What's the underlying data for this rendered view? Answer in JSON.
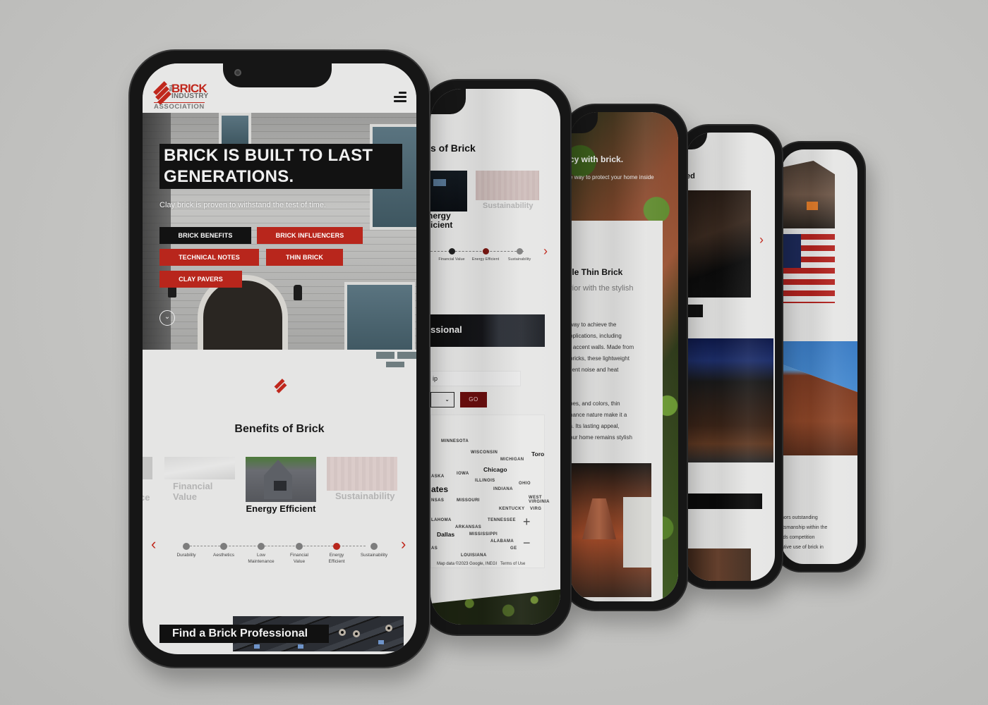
{
  "phone1": {
    "logo": {
      "the": "THE",
      "brick": "BRICK",
      "industry": "INDUSTRY",
      "association": "ASSOCIATION"
    },
    "menu_icon": "hamburger-menu-icon",
    "hero": {
      "title": "BRICK IS BUILT TO LAST GENERATIONS.",
      "subtitle": "Clay brick is proven to withstand the test of time.",
      "buttons": [
        {
          "label": "BRICK BENEFITS",
          "style": "black"
        },
        {
          "label": "BRICK INFLUENCERS",
          "style": "red"
        },
        {
          "label": "TECHNICAL NOTES",
          "style": "red"
        },
        {
          "label": "THIN BRICK",
          "style": "red"
        },
        {
          "label": "CLAY PAVERS",
          "style": "red"
        }
      ],
      "scroll_icon": "chevron-down-circle-icon"
    },
    "benefits": {
      "title": "Benefits of Brick",
      "cards": [
        {
          "label": "Low Maintenance",
          "visible_text": "ce",
          "state": "faded"
        },
        {
          "label": "Financial Value",
          "state": "faded"
        },
        {
          "label": "Energy Efficient",
          "state": "active"
        },
        {
          "label": "Sustainability",
          "state": "faded"
        }
      ],
      "timeline": [
        {
          "label": "Durability",
          "active": false
        },
        {
          "label": "Aesthetics",
          "active": false
        },
        {
          "label": "Low Maintenance",
          "active": false
        },
        {
          "label": "Financial Value",
          "active": false
        },
        {
          "label": "Energy Efficient",
          "active": true
        },
        {
          "label": "Sustainability",
          "active": false
        }
      ],
      "prev_icon": "chevron-left-icon",
      "next_icon": "chevron-right-icon"
    },
    "find_pro": {
      "label": "Find a Brick Professional"
    }
  },
  "phone2": {
    "title": "s of Brick",
    "cards": [
      {
        "label": "nergy\nficient"
      },
      {
        "label": "Sustainability"
      }
    ],
    "timeline": [
      {
        "label": "Financial Value",
        "active": false
      },
      {
        "label": "Energy Efficient",
        "active": true
      },
      {
        "label": "Sustainability",
        "active": false
      }
    ],
    "pro_banner": "ssional",
    "zip_input": "ip",
    "select_icon": "chevron-down-icon",
    "go_button": "GO",
    "map": {
      "labels": [
        "MINNESOTA",
        "WISCONSIN",
        "MICHIGAN",
        "IOWA",
        "ILLINOIS",
        "INDIANA",
        "OHIO",
        "MISSOURI",
        "KENTUCKY",
        "TENNESSEE",
        "ARKANSAS",
        "MISSISSIPPI",
        "ALABAMA",
        "LOUISIANA",
        "WEST VIRGINIA",
        "ASKA",
        "NSAS",
        "LAHOMA",
        "AS",
        "VIRG",
        "GE"
      ],
      "cities": [
        "Chicago",
        "Dallas",
        "Toro"
      ],
      "big_label": "ates",
      "attribution": "Map data ©2023 Google, INEGI",
      "terms": "Terms of Use",
      "zoom_in": "+",
      "zoom_out": "−"
    }
  },
  "phone3": {
    "heading": "cy with brick.",
    "subtext": "e way to protect your home inside",
    "card_title": "ile Thin Brick",
    "card_sub": "rior with the stylish",
    "para1": [
      "way to achieve the",
      "pplications, including",
      "r accent walls. Made from",
      "bricks, these lightweight",
      "llent noise and heat"
    ],
    "para2": [
      "pes, and colors, thin",
      "nance nature make it a",
      "s. Its lasting appeal,",
      "our home remains stylish"
    ]
  },
  "phone4": {
    "title": "ed",
    "next_icon": "chevron-right-icon"
  },
  "phone5": {
    "para": [
      "nors outstanding",
      "ftsmanship within the",
      "rds competition",
      "ative use of brick in"
    ]
  },
  "colors": {
    "brand_red": "#b8261c",
    "dark": "#121212",
    "background": "#c4c4c2"
  }
}
